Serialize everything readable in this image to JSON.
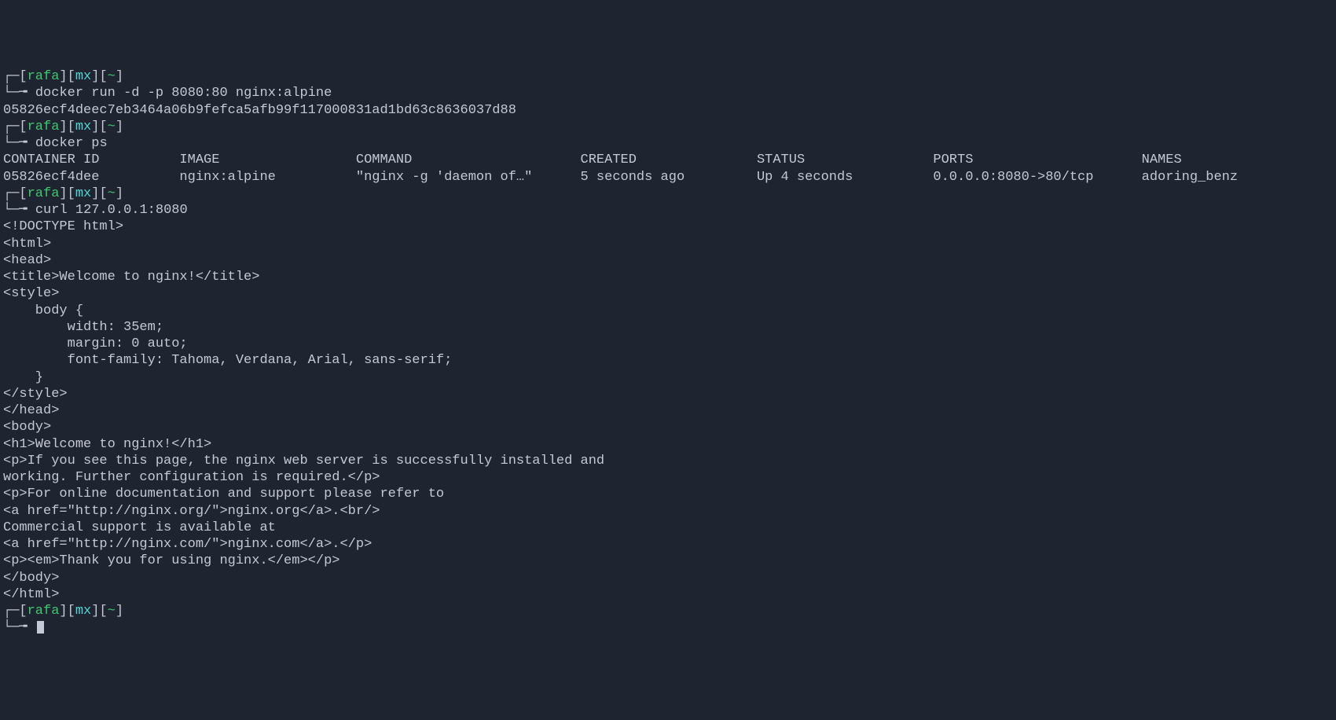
{
  "prompt": {
    "corner_tl": "┌─",
    "corner_bl": "└─",
    "lb": "[",
    "rb": "]",
    "user": "rafa",
    "host": "mx",
    "path": "~",
    "arrow": "╼"
  },
  "blocks": [
    {
      "type": "prompt_cmd",
      "cmd": "docker run -d -p 8080:80 nginx:alpine"
    },
    {
      "type": "out",
      "text": "05826ecf4deec7eb3464a06b9fefca5afb99f117000831ad1bd63c8636037d88"
    },
    {
      "type": "prompt_cmd",
      "cmd": "docker ps"
    },
    {
      "type": "ps_table",
      "headers": [
        "CONTAINER ID",
        "IMAGE",
        "COMMAND",
        "CREATED",
        "STATUS",
        "PORTS",
        "NAMES"
      ],
      "row": [
        "05826ecf4dee",
        "nginx:alpine",
        "\"nginx -g 'daemon of…\"",
        "5 seconds ago",
        "Up 4 seconds",
        "0.0.0.0:8080->80/tcp",
        "adoring_benz"
      ]
    },
    {
      "type": "prompt_cmd",
      "cmd": "curl 127.0.0.1:8080"
    },
    {
      "type": "out",
      "text": "<!DOCTYPE html>"
    },
    {
      "type": "out",
      "text": "<html>"
    },
    {
      "type": "out",
      "text": "<head>"
    },
    {
      "type": "out",
      "text": "<title>Welcome to nginx!</title>"
    },
    {
      "type": "out",
      "text": "<style>"
    },
    {
      "type": "out",
      "text": "    body {"
    },
    {
      "type": "out",
      "text": "        width: 35em;"
    },
    {
      "type": "out",
      "text": "        margin: 0 auto;"
    },
    {
      "type": "out",
      "text": "        font-family: Tahoma, Verdana, Arial, sans-serif;"
    },
    {
      "type": "out",
      "text": "    }"
    },
    {
      "type": "out",
      "text": "</style>"
    },
    {
      "type": "out",
      "text": "</head>"
    },
    {
      "type": "out",
      "text": "<body>"
    },
    {
      "type": "out",
      "text": "<h1>Welcome to nginx!</h1>"
    },
    {
      "type": "out",
      "text": "<p>If you see this page, the nginx web server is successfully installed and"
    },
    {
      "type": "out",
      "text": "working. Further configuration is required.</p>"
    },
    {
      "type": "out",
      "text": ""
    },
    {
      "type": "out",
      "text": "<p>For online documentation and support please refer to"
    },
    {
      "type": "out",
      "text": "<a href=\"http://nginx.org/\">nginx.org</a>.<br/>"
    },
    {
      "type": "out",
      "text": "Commercial support is available at"
    },
    {
      "type": "out",
      "text": "<a href=\"http://nginx.com/\">nginx.com</a>.</p>"
    },
    {
      "type": "out",
      "text": ""
    },
    {
      "type": "out",
      "text": "<p><em>Thank you for using nginx.</em></p>"
    },
    {
      "type": "out",
      "text": "</body>"
    },
    {
      "type": "out",
      "text": "</html>"
    },
    {
      "type": "prompt_empty"
    }
  ],
  "ps_cols": [
    0,
    22,
    44,
    72,
    94,
    116,
    142
  ]
}
